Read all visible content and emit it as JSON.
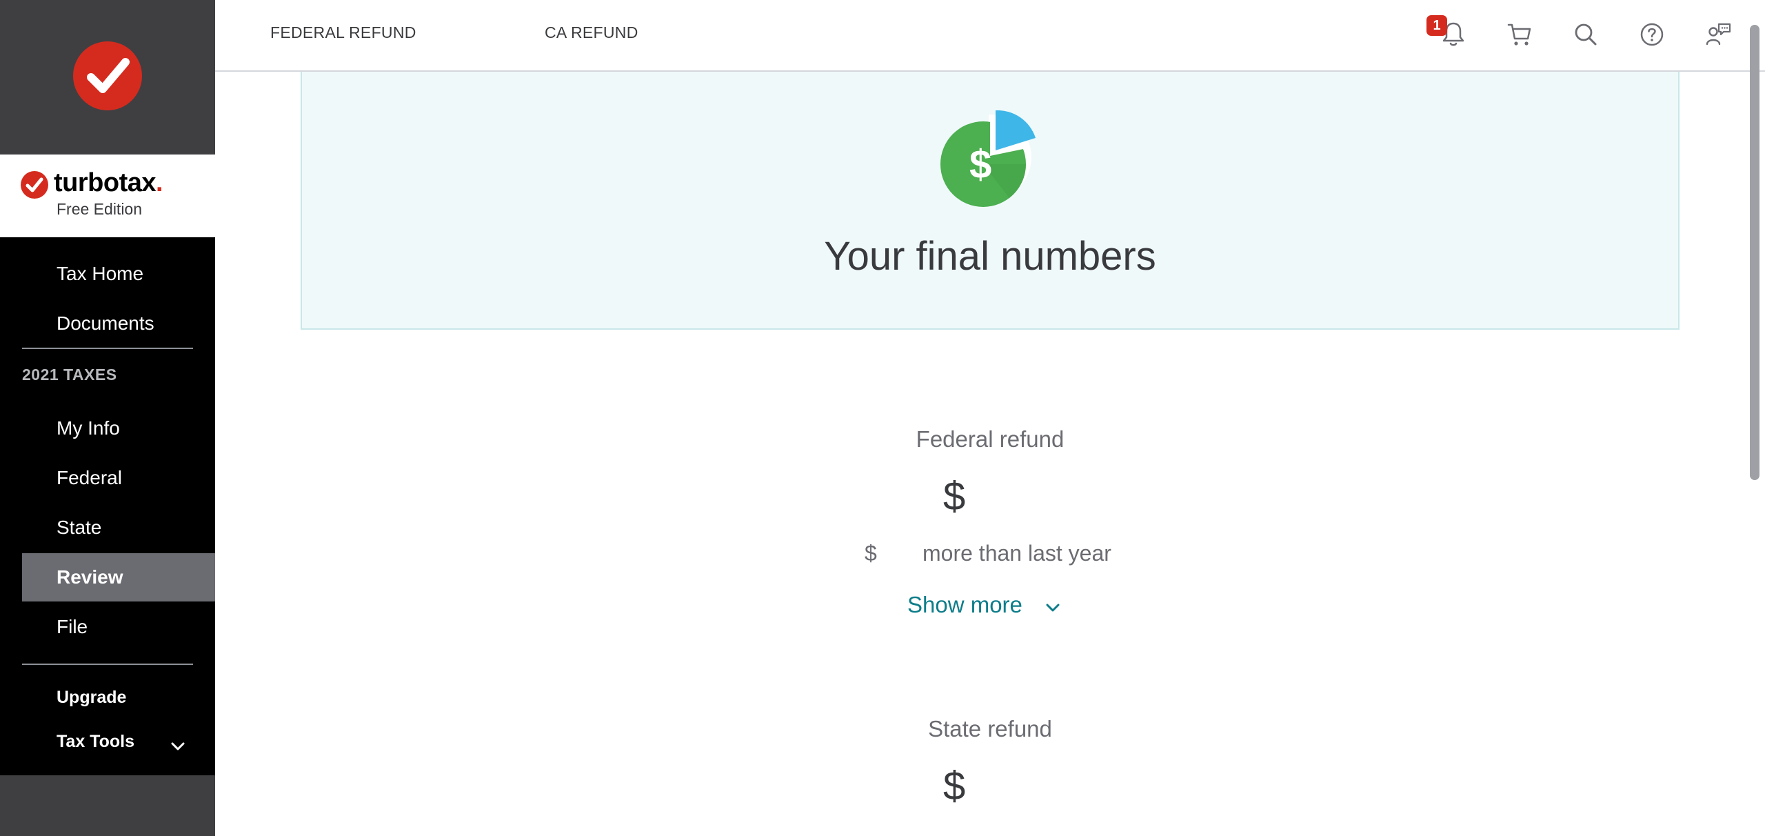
{
  "brand": {
    "name": "turbotax",
    "edition": "Free Edition"
  },
  "sidebar": {
    "top_items": [
      {
        "label": "Tax Home"
      },
      {
        "label": "Documents"
      }
    ],
    "section_label": "2021 TAXES",
    "tax_items": [
      {
        "label": "My Info"
      },
      {
        "label": "Federal"
      },
      {
        "label": "State"
      },
      {
        "label": "Review",
        "active": true
      },
      {
        "label": "File"
      }
    ],
    "bottom_items": [
      {
        "label": "Upgrade"
      },
      {
        "label": "Tax Tools"
      }
    ]
  },
  "header": {
    "tabs": [
      {
        "label": "FEDERAL REFUND"
      },
      {
        "label": "CA REFUND"
      }
    ],
    "notification_count": "1",
    "icons": [
      "bell-icon",
      "cart-icon",
      "search-icon",
      "help-icon",
      "chat-expert-icon"
    ]
  },
  "main": {
    "title": "Your final numbers",
    "federal": {
      "label": "Federal refund",
      "amount": "$",
      "diff_currency": "$",
      "diff_text": "more than last year",
      "show_more": "Show more"
    },
    "state": {
      "label": "State refund",
      "amount": "$"
    }
  },
  "colors": {
    "sidebar_bg": "#3f3f42",
    "nav_bg": "#000000",
    "active_item_bg": "#6b6c72",
    "brand_red": "#d52b1e",
    "link_teal": "#0d7d8a",
    "banner_bg": "#eff9fa",
    "pie_green": "#4caf50",
    "pie_blue": "#3fb6e8"
  }
}
